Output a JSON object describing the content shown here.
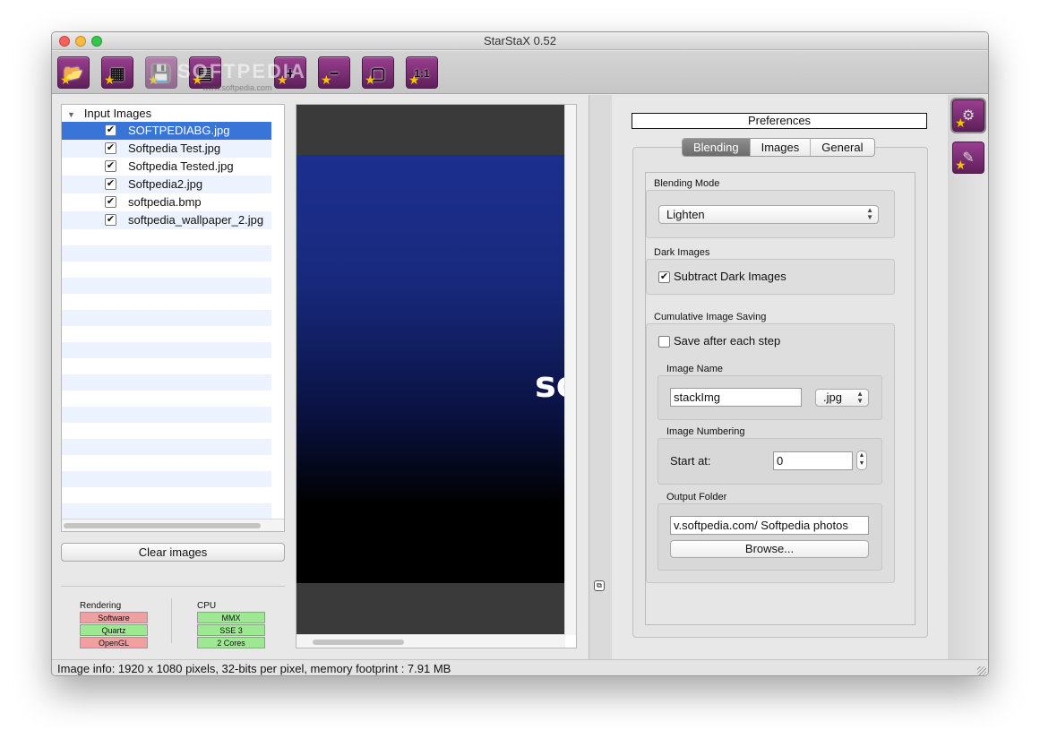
{
  "window": {
    "title": "StarStaX 0.52"
  },
  "toolbar": {
    "buttons": [
      {
        "name": "open-images-button",
        "symbol": "📂"
      },
      {
        "name": "open-dark-button",
        "symbol": "▦"
      },
      {
        "name": "save-button",
        "symbol": "💾"
      },
      {
        "name": "start-processing-button",
        "symbol": "▤"
      },
      {
        "name": "zoom-in-button",
        "symbol": "+"
      },
      {
        "name": "zoom-out-button",
        "symbol": "−"
      },
      {
        "name": "fit-to-window-button",
        "symbol": "▢"
      },
      {
        "name": "actual-size-button",
        "symbol": "1:1"
      }
    ],
    "watermark": "SOFTPEDIA",
    "watermark_url": "www.softpedia.com"
  },
  "file_list": {
    "header": "Input Images",
    "items": [
      {
        "label": "SOFTPEDIABG.jpg",
        "checked": "✔",
        "selected": true
      },
      {
        "label": "Softpedia Test.jpg",
        "checked": "✔"
      },
      {
        "label": "Softpedia Tested.jpg",
        "checked": "✔"
      },
      {
        "label": "Softpedia2.jpg",
        "checked": "✔"
      },
      {
        "label": "softpedia.bmp",
        "checked": "✔"
      },
      {
        "label": "softpedia_wallpaper_2.jpg",
        "checked": "✔"
      }
    ],
    "clear_button": "Clear images"
  },
  "rendering": {
    "label": "Rendering",
    "items": [
      {
        "label": "Software",
        "color": "#f0a0a0"
      },
      {
        "label": "Quartz",
        "color": "#9ee893"
      },
      {
        "label": "OpenGL",
        "color": "#f0a0a0"
      }
    ]
  },
  "cpu": {
    "label": "CPU",
    "items": [
      {
        "label": "MMX",
        "color": "#9ee893"
      },
      {
        "label": "SSE 3",
        "color": "#9ee893"
      },
      {
        "label": "2 Cores",
        "color": "#9ee893"
      }
    ]
  },
  "preview": {
    "text": "sc"
  },
  "preferences": {
    "title": "Preferences",
    "tabs": [
      {
        "label": "Blending",
        "active": true
      },
      {
        "label": "Images",
        "active": false
      },
      {
        "label": "General",
        "active": false
      }
    ],
    "blending_mode": {
      "label": "Blending Mode",
      "value": "Lighten"
    },
    "dark_images": {
      "label": "Dark Images",
      "checkbox_label": "Subtract Dark Images",
      "checked": "✔"
    },
    "cumulative": {
      "label": "Cumulative Image Saving",
      "checkbox_label": "Save after each step",
      "checked": "",
      "image_name": {
        "label": "Image Name",
        "value": "stackImg",
        "format": ".jpg"
      },
      "numbering": {
        "label": "Image Numbering",
        "start_label": "Start at:",
        "start_value": "0"
      },
      "output": {
        "label": "Output Folder",
        "path": "v.softpedia.com/ Softpedia photos",
        "browse": "Browse..."
      }
    }
  },
  "sidebar": {
    "buttons": [
      {
        "name": "preferences-panel-button",
        "symbol": "⚙"
      },
      {
        "name": "tools-panel-button",
        "symbol": "✎"
      }
    ]
  },
  "status": {
    "text": "Image info: 1920 x 1080 pixels, 32-bits per pixel, memory footprint :  7.91 MB"
  },
  "accent_color": "#3875d7"
}
